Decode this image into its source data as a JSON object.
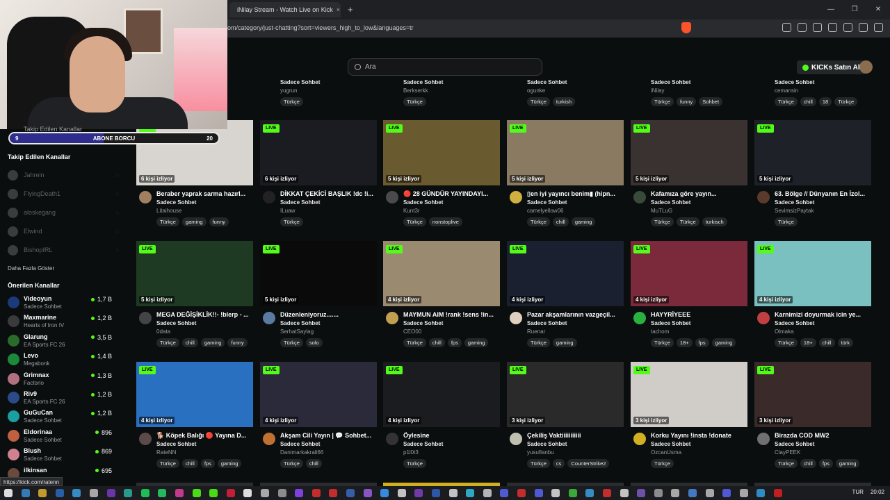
{
  "browser": {
    "tab_title": "iNilay Stream - Watch Live on Kick",
    "url": "om/category/just-chatting?sort=viewers_high_to_low&languages=tr",
    "status_url": "https://kick.com/ratenn"
  },
  "header": {
    "search_placeholder": "Ara",
    "buy_label": "KICKs Satın Al"
  },
  "overlay": {
    "sub_goal_left": "9",
    "sub_goal_label": "ABONE BORCU",
    "sub_goal_right": "20",
    "sub_goal_progress": 0.45,
    "partial_label": "Takip Edilen Kanallar"
  },
  "sidebar": {
    "followed_title": "Takip Edilen Kanallar",
    "followed": [
      {
        "name": "Jahrein"
      },
      {
        "name": "FlyingDeath1"
      },
      {
        "name": "aloskegang"
      },
      {
        "name": "Elwind"
      },
      {
        "name": "BishopIRL"
      }
    ],
    "show_more": "Daha Fazla Göster",
    "recommended_title": "Önerilen Kanallar",
    "recommended": [
      {
        "name": "Videoyun",
        "category": "Sadece Sohbet",
        "viewers": "1,7 B",
        "color": "#1b3a7a"
      },
      {
        "name": "Maxmarine",
        "category": "Hearts of Iron IV",
        "viewers": "1,2 B",
        "color": "#3a3a3a"
      },
      {
        "name": "Glarung",
        "category": "EA Sports FC 26",
        "viewers": "3,5 B",
        "color": "#2a6a2a"
      },
      {
        "name": "Levo",
        "category": "Megabonk",
        "viewers": "1,4 B",
        "color": "#1a8a3a"
      },
      {
        "name": "Grimnax",
        "category": "Factorio",
        "viewers": "1,3 B",
        "color": "#b07080"
      },
      {
        "name": "Riv9",
        "category": "EA Sports FC 26",
        "viewers": "1,2 B",
        "color": "#2a4a8a"
      },
      {
        "name": "GuGuCan",
        "category": "Sadece Sohbet",
        "viewers": "1,2 B",
        "color": "#1aa0a0"
      },
      {
        "name": "Eldorinaa",
        "category": "Sadece Sohbet",
        "viewers": "896",
        "color": "#c06040"
      },
      {
        "name": "Blush",
        "category": "Sadece Sohbet",
        "viewers": "869",
        "color": "#d08090"
      },
      {
        "name": "ilkinsan",
        "category": "",
        "viewers": "695",
        "color": "#6a4a3a"
      }
    ]
  },
  "top_row": [
    {
      "category": "Sadece Sohbet",
      "name": "yugrun",
      "tags": [
        "Türkçe"
      ]
    },
    {
      "category": "Sadece Sohbet",
      "name": "Berkserkk",
      "tags": [
        "Türkçe"
      ]
    },
    {
      "category": "Sadece Sohbet",
      "name": "ogunke",
      "tags": [
        "Türkçe",
        "turkish"
      ]
    },
    {
      "category": "Sadece Sohbet",
      "name": "iNilay",
      "tags": [
        "Türkçe",
        "funny",
        "Sohbet"
      ]
    },
    {
      "category": "Sadece Sohbet",
      "name": "cemansin",
      "tags": [
        "Türkçe",
        "chill",
        "18",
        "Türkçe"
      ]
    }
  ],
  "streams": [
    {
      "live": "LIVE",
      "viewers": "6 kişi izliyor",
      "title": "Beraber yaprak sarma hazırl...",
      "category": "Sadece Sohbet",
      "name": "Litaihouse",
      "tags": [
        "Türkçe",
        "gaming",
        "funny"
      ],
      "thumb": "#d8d4cf",
      "avatar": "#a08060"
    },
    {
      "live": "LIVE",
      "viewers": "6 kişi izliyor",
      "title": "DİKKAT ÇEKİCİ BAŞLIK !dc !i...",
      "category": "Sadece Sohbet",
      "name": "ILuaw",
      "tags": [
        "Türkçe"
      ],
      "thumb": "#1a1c22",
      "avatar": "#222222"
    },
    {
      "live": "LIVE",
      "viewers": "5 kişi izliyor",
      "title": "🔴 28 GÜNDÜR YAYINDAYI...",
      "category": "Sadece Sohbet",
      "name": "Kunt3r",
      "tags": [
        "Türkçe",
        "nonstoplive"
      ],
      "thumb": "#6a5a30",
      "avatar": "#4a4a4a"
    },
    {
      "live": "LIVE",
      "viewers": "5 kişi izliyor",
      "title": "▯en iyi yayıncı benim▮ (hipn...",
      "category": "Sadece Sohbet",
      "name": "camelyellow06",
      "tags": [
        "Türkçe",
        "chill",
        "gaming"
      ],
      "thumb": "#8a7a62",
      "avatar": "#d0b040"
    },
    {
      "live": "LIVE",
      "viewers": "5 kişi izliyor",
      "title": "Kafamıza göre yayın...",
      "category": "Sadece Sohbet",
      "name": "MuTLuG",
      "tags": [
        "Türkçe",
        "Türkçe",
        "turkisch"
      ],
      "thumb": "#3a3230",
      "avatar": "#3a4a3a"
    },
    {
      "live": "LIVE",
      "viewers": "5 kişi izliyor",
      "title": "63. Bölge // Dünyanın En İzol...",
      "category": "Sadece Sohbet",
      "name": "SevimsizPaytak",
      "tags": [
        "Türkçe"
      ],
      "thumb": "#1e2228",
      "avatar": "#5a3a2a"
    },
    {
      "live": "LIVE",
      "viewers": "5 kişi izliyor",
      "title": "MEGA DEĞİŞİKLİK!!- !blerp - ...",
      "category": "Sadece Sohbet",
      "name": "0data",
      "tags": [
        "Türkçe",
        "chill",
        "gaming",
        "funny"
      ],
      "thumb": "#1e3a22",
      "avatar": "#444444"
    },
    {
      "live": "LIVE",
      "viewers": "5 kişi izliyor",
      "title": "Düzenleniyoruz.......",
      "category": "Sadece Sohbet",
      "name": "SerhatSaylag",
      "tags": [
        "Türkçe",
        "solo"
      ],
      "thumb": "#0a0a0a",
      "avatar": "#5a7aa0"
    },
    {
      "live": "LIVE",
      "viewers": "4 kişi izliyor",
      "title": "MAYMUN AIM !rank !sens !in...",
      "category": "Sadece Sohbet",
      "name": "CEO00",
      "tags": [
        "Türkçe",
        "chill",
        "fps",
        "gaming"
      ],
      "thumb": "#9a8a70",
      "avatar": "#c0a050"
    },
    {
      "live": "LIVE",
      "viewers": "4 kişi izliyor",
      "title": "Pazar akşamlarının vazgeçil...",
      "category": "Sadece Sohbet",
      "name": "Ruenar",
      "tags": [
        "Türkçe",
        "gaming"
      ],
      "thumb": "#1a2030",
      "avatar": "#e0d0c0"
    },
    {
      "live": "LIVE",
      "viewers": "4 kişi izliyor",
      "title": "HAYYRİYEEE",
      "category": "Sadece Sohbet",
      "name": "tachom",
      "tags": [
        "Türkçe",
        "18+",
        "fps",
        "gaming"
      ],
      "thumb": "#7a2a3a",
      "avatar": "#2ab040"
    },
    {
      "live": "LIVE",
      "viewers": "4 kişi izliyor",
      "title": "Karnimizi doyurmak icin ye...",
      "category": "Sadece Sohbet",
      "name": "Olmaka",
      "tags": [
        "Türkçe",
        "18+",
        "chill",
        "türk"
      ],
      "thumb": "#7ac0c0",
      "avatar": "#c04040"
    },
    {
      "live": "LIVE",
      "viewers": "4 kişi izliyor",
      "title": "🐕 Köpek Balığı 🔴 Yayına D...",
      "category": "Sadece Sohbet",
      "name": "RateNN",
      "tags": [
        "Türkçe",
        "chill",
        "fps",
        "gaming"
      ],
      "thumb": "#2a70c0",
      "avatar": "#5a4a4a"
    },
    {
      "live": "LIVE",
      "viewers": "4 kişi izliyor",
      "title": "Akşam Cili Yayın | 💬 Sohbet...",
      "category": "Sadece Sohbet",
      "name": "Danimarkakrali66",
      "tags": [
        "Türkçe",
        "chill"
      ],
      "thumb": "#2a2a3a",
      "avatar": "#c07030"
    },
    {
      "live": "LIVE",
      "viewers": "4 kişi izliyor",
      "title": "Öylesine",
      "category": "Sadece Sohbet",
      "name": "p1l0t3",
      "tags": [
        "Türkçe"
      ],
      "thumb": "#1a1c20",
      "avatar": "#333333"
    },
    {
      "live": "LIVE",
      "viewers": "3 kişi izliyor",
      "title": "Çekiliş Vaktiiiiiiiiiii",
      "category": "Sadece Sohbet",
      "name": "yusuflanbu",
      "tags": [
        "Türkçe",
        "cs",
        "CounterStrike2"
      ],
      "thumb": "#2a2a2a",
      "avatar": "#c0c0b0"
    },
    {
      "live": "LIVE",
      "viewers": "3 kişi izliyor",
      "title": "Korku Yayını !insta !donate",
      "category": "Sadece Sohbet",
      "name": "OzcanUsma",
      "tags": [
        "Türkçe"
      ],
      "thumb": "#d0ccc8",
      "avatar": "#d0b020"
    },
    {
      "live": "LIVE",
      "viewers": "3 kişi izliyor",
      "title": "Birazda COD MW2",
      "category": "Sadece Sohbet",
      "name": "ClayPEEK",
      "tags": [
        "Türkçe",
        "chill",
        "fps",
        "gaming"
      ],
      "thumb": "#3a2a2a",
      "avatar": "#707070"
    }
  ],
  "taskbar": {
    "lang": "TUR",
    "time": "20:02"
  }
}
